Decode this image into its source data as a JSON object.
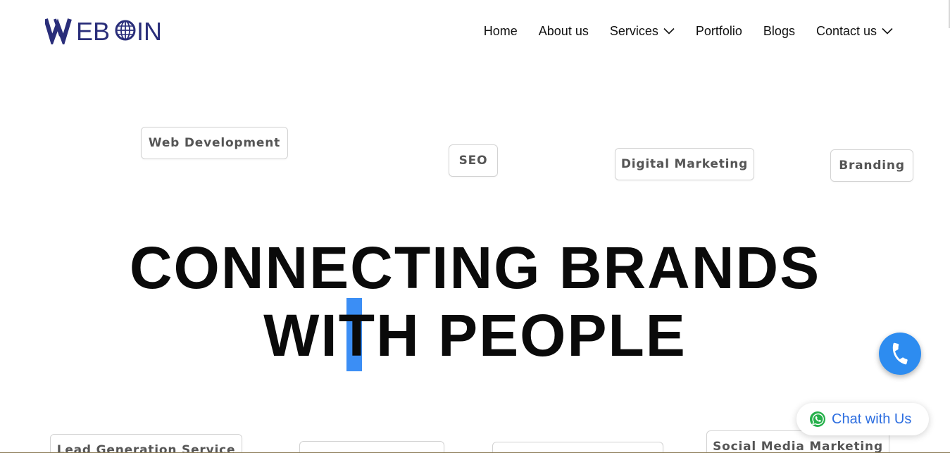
{
  "brand": {
    "logo_text": "WEBOIN",
    "color": "#2a2e7a"
  },
  "nav": {
    "items": [
      {
        "label": "Home",
        "dropdown": false
      },
      {
        "label": "About us",
        "dropdown": false
      },
      {
        "label": "Services",
        "dropdown": true
      },
      {
        "label": "Portfolio",
        "dropdown": false
      },
      {
        "label": "Blogs",
        "dropdown": false
      },
      {
        "label": "Contact us",
        "dropdown": true
      }
    ]
  },
  "tags": {
    "web_development": "Web Development",
    "seo": "SEO",
    "digital_marketing": "Digital Marketing",
    "branding": "Branding",
    "lead_generation": "Lead Generation Service",
    "social_media_marketing": "Social Media Marketing"
  },
  "hero": {
    "line1": "CONNECTING BRANDS",
    "line2": "WITH PEOPLE"
  },
  "floating": {
    "call_icon": "phone-icon",
    "chat_icon": "whatsapp-icon",
    "chat_label": "Chat with Us",
    "accent": "#2d8cf0",
    "whatsapp_color": "#25b04a"
  }
}
